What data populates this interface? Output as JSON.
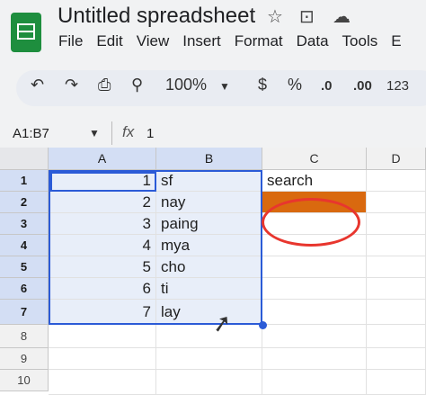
{
  "app": {
    "title": "Untitled spreadsheet",
    "logo_icon": "sheets-logo-icon"
  },
  "title_icons": [
    "star-icon",
    "move-to-folder-icon",
    "cloud-status-icon"
  ],
  "menu": [
    "File",
    "Edit",
    "View",
    "Insert",
    "Format",
    "Data",
    "Tools",
    "E"
  ],
  "toolbar": {
    "undo_icon": "undo-icon",
    "redo_icon": "redo-icon",
    "print_icon": "print-icon",
    "paint_format_icon": "paint-format-icon",
    "zoom": "100%",
    "currency": "$",
    "percent": "%",
    "decrease_decimal": ".0",
    "increase_decimal": ".00",
    "number_format": "123"
  },
  "formula_bar": {
    "name_box": "A1:B7",
    "fx_label": "fx",
    "value": "1"
  },
  "columns": [
    "A",
    "B",
    "C",
    "D"
  ],
  "rows": [
    "1",
    "2",
    "3",
    "4",
    "5",
    "6",
    "7",
    "8",
    "9",
    "10"
  ],
  "cells": {
    "A": [
      "1",
      "2",
      "3",
      "4",
      "5",
      "6",
      "7"
    ],
    "B": [
      "sf",
      "nay",
      "paing",
      "mya",
      "cho",
      "ti",
      "lay"
    ],
    "C1": "search"
  },
  "colors": {
    "selection": "#2b5bd7",
    "highlight_cell": "#d9690f",
    "annotation_circle": "#e8362e"
  }
}
